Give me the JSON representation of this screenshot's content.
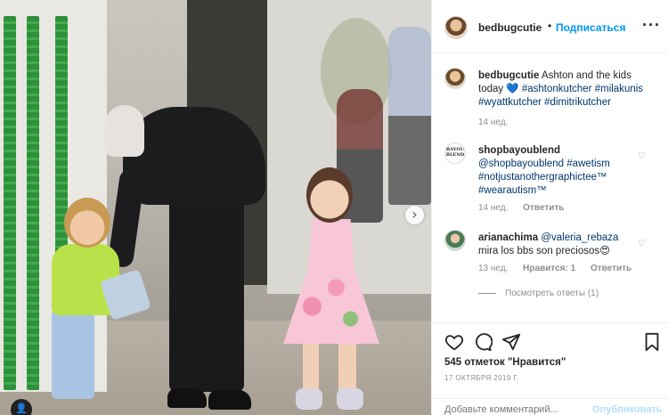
{
  "photo": {
    "next_icon": "chevron-right-icon",
    "next_glyph": "›",
    "tag_icon": "person-tag-icon",
    "tag_glyph": "👤"
  },
  "post": {
    "username": "bedbugcutie",
    "dot": "•",
    "follow_label": "Подписаться",
    "more_glyph": "···"
  },
  "comments": [
    {
      "username": "bedbugcutie",
      "text_before": "Ashton and the kids today",
      "emoji": "💙",
      "hashtags": [
        "#ashtonkutcher",
        "#milakunis",
        "#wyattkutcher",
        "#dimitrikutcher"
      ],
      "time": "14 нед."
    },
    {
      "username": "shopbayoublend",
      "avatar_text": "BAYOU BLEND",
      "text": "@shopbayoublend #awetism #notjustanothergraphictee™ #wearautism™",
      "time": "14 нед.",
      "reply_label": "Ответить"
    },
    {
      "username": "arianachima",
      "mention": "@valeria_rebaza",
      "text": "mira los bbs son preciosos",
      "emoji": "😍",
      "time": "13 нед.",
      "likes_label": "Нравится: 1",
      "reply_label": "Ответить"
    }
  ],
  "view_replies_label": "Посмотреть ответы (1)",
  "actions": {
    "like_icon": "heart-icon",
    "comment_icon": "comment-icon",
    "share_icon": "share-icon",
    "save_icon": "bookmark-icon"
  },
  "likes_text": "545 отметок \"Нравится\"",
  "date_text": "17 ОКТЯБРЯ 2019 Г.",
  "add_comment": {
    "placeholder": "Добавьте комментарий...",
    "post_label": "Опубликовать"
  },
  "colors": {
    "link_blue": "#0095f6",
    "hashtag": "#00376b",
    "muted": "#8e8e8e",
    "post_disabled": "#b2dffc"
  }
}
